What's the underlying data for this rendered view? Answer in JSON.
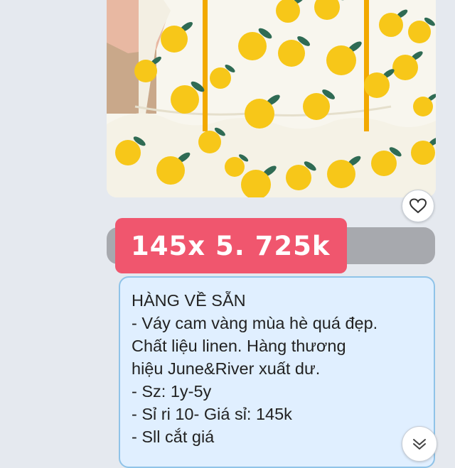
{
  "product_photo": {
    "subject": "child dress with yellow orange print",
    "colors": {
      "fabric": "#f8f6ee",
      "fruit": "#f7c719",
      "leaf": "#2f6b54",
      "piping": "#f2a900",
      "skin": "#e8b8a2",
      "wood": "#c9a88a"
    }
  },
  "reaction": {
    "icon": "heart-outline-icon"
  },
  "price_badge": {
    "text": "145x 5. 725k",
    "color": "#f0566e"
  },
  "message": {
    "lines": [
      "HÀNG VỀ SẴN",
      "- Váy cam vàng mùa hè quá đẹp.",
      "Chất liệu linen. Hàng thương",
      "hiệu June&River xuất dư.",
      "- Sz: 1y-5y",
      "- Sỉ ri 10- Giá sỉ: 145k",
      "- Sll cắt giá"
    ]
  },
  "scroll_button": {
    "icon": "chevron-down-icon"
  }
}
